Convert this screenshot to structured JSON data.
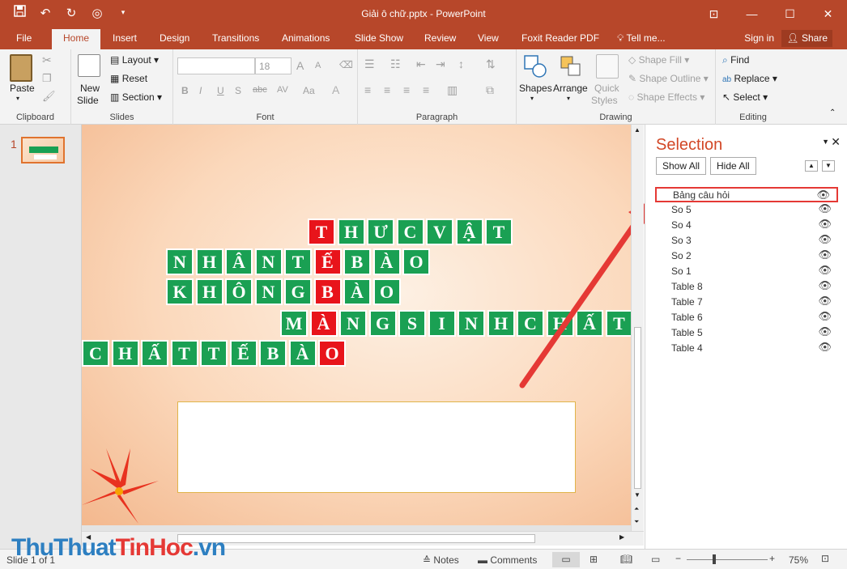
{
  "app": {
    "title": "Giải ô chữ.pptx - PowerPoint",
    "qat_icons": [
      "save-icon",
      "undo-icon",
      "redo-icon",
      "start-from-beginning-icon",
      "customize-qat-icon"
    ]
  },
  "tabs": [
    "File",
    "Home",
    "Insert",
    "Design",
    "Transitions",
    "Animations",
    "Slide Show",
    "Review",
    "View",
    "Foxit Reader PDF",
    "Tell me..."
  ],
  "account": {
    "sign_in": "Sign in",
    "share": "Share"
  },
  "ribbon": {
    "clipboard": {
      "label": "Clipboard",
      "paste": "Paste"
    },
    "slides": {
      "label": "Slides",
      "new_slide_1": "New",
      "new_slide_2": "Slide",
      "layout": "Layout",
      "reset": "Reset",
      "section": "Section"
    },
    "font": {
      "label": "Font",
      "font_size": "18",
      "bold": "B",
      "italic": "I",
      "underline": "U",
      "shadow": "S",
      "strike": "abc",
      "spacing": "AV",
      "case": "Aa",
      "grow": "A",
      "shrink": "A"
    },
    "paragraph": {
      "label": "Paragraph"
    },
    "drawing": {
      "label": "Drawing",
      "shapes": "Shapes",
      "arrange": "Arrange",
      "quick_styles_1": "Quick",
      "quick_styles_2": "Styles",
      "shape_fill": "Shape Fill",
      "shape_outline": "Shape Outline",
      "shape_effects": "Shape Effects"
    },
    "editing": {
      "label": "Editing",
      "find": "Find",
      "replace": "Replace",
      "select": "Select"
    }
  },
  "thumbnails": {
    "slide_number": "1"
  },
  "slide": {
    "rows": [
      {
        "cells": [
          {
            "ch": "T",
            "key": true
          },
          {
            "ch": "H"
          },
          {
            "ch": "Ư"
          },
          {
            "ch": "C"
          },
          {
            "ch": "V"
          },
          {
            "ch": "Ậ"
          },
          {
            "ch": "T"
          }
        ]
      },
      {
        "cells": [
          {
            "ch": "N"
          },
          {
            "ch": "H"
          },
          {
            "ch": "Â"
          },
          {
            "ch": "N"
          },
          {
            "ch": "T"
          },
          {
            "ch": "Ế",
            "key": true
          },
          {
            "ch": "B"
          },
          {
            "ch": "À"
          },
          {
            "ch": "O"
          }
        ]
      },
      {
        "cells": [
          {
            "ch": "K"
          },
          {
            "ch": "H"
          },
          {
            "ch": "Ô"
          },
          {
            "ch": "N"
          },
          {
            "ch": "G"
          },
          {
            "ch": "B",
            "key": true
          },
          {
            "ch": "À"
          },
          {
            "ch": "O"
          }
        ]
      },
      {
        "cells": [
          {
            "ch": "M"
          },
          {
            "ch": "À",
            "key": true
          },
          {
            "ch": "N"
          },
          {
            "ch": "G"
          },
          {
            "ch": "S"
          },
          {
            "ch": "I"
          },
          {
            "ch": "N"
          },
          {
            "ch": "H"
          },
          {
            "ch": "C"
          },
          {
            "ch": "H"
          },
          {
            "ch": "Ấ"
          },
          {
            "ch": "T"
          }
        ]
      },
      {
        "cells": [
          {
            "ch": "C"
          },
          {
            "ch": "H"
          },
          {
            "ch": "Ấ"
          },
          {
            "ch": "T"
          },
          {
            "ch": "T"
          },
          {
            "ch": "Ế"
          },
          {
            "ch": "B"
          },
          {
            "ch": "À"
          },
          {
            "ch": "O",
            "key": true
          }
        ]
      }
    ],
    "colors": {
      "cell": "#1aa053",
      "key_cell": "#e8141b",
      "arrow": "#e53935"
    }
  },
  "selection_pane": {
    "title": "Selection",
    "show_all": "Show All",
    "hide_all": "Hide All",
    "items": [
      "Bảng câu hỏi",
      "So 5",
      "So 4",
      "So 3",
      "So 2",
      "So 1",
      "Table 8",
      "Table 7",
      "Table 6",
      "Table 5",
      "Table 4"
    ],
    "selected_index": 0
  },
  "status": {
    "slide_info": "Slide 1 of 1",
    "notes": "Notes",
    "comments": "Comments",
    "zoom": "75%"
  },
  "watermark": {
    "part1": "ThuThuat",
    "part2": "TinHoc",
    "part3": ".vn"
  }
}
